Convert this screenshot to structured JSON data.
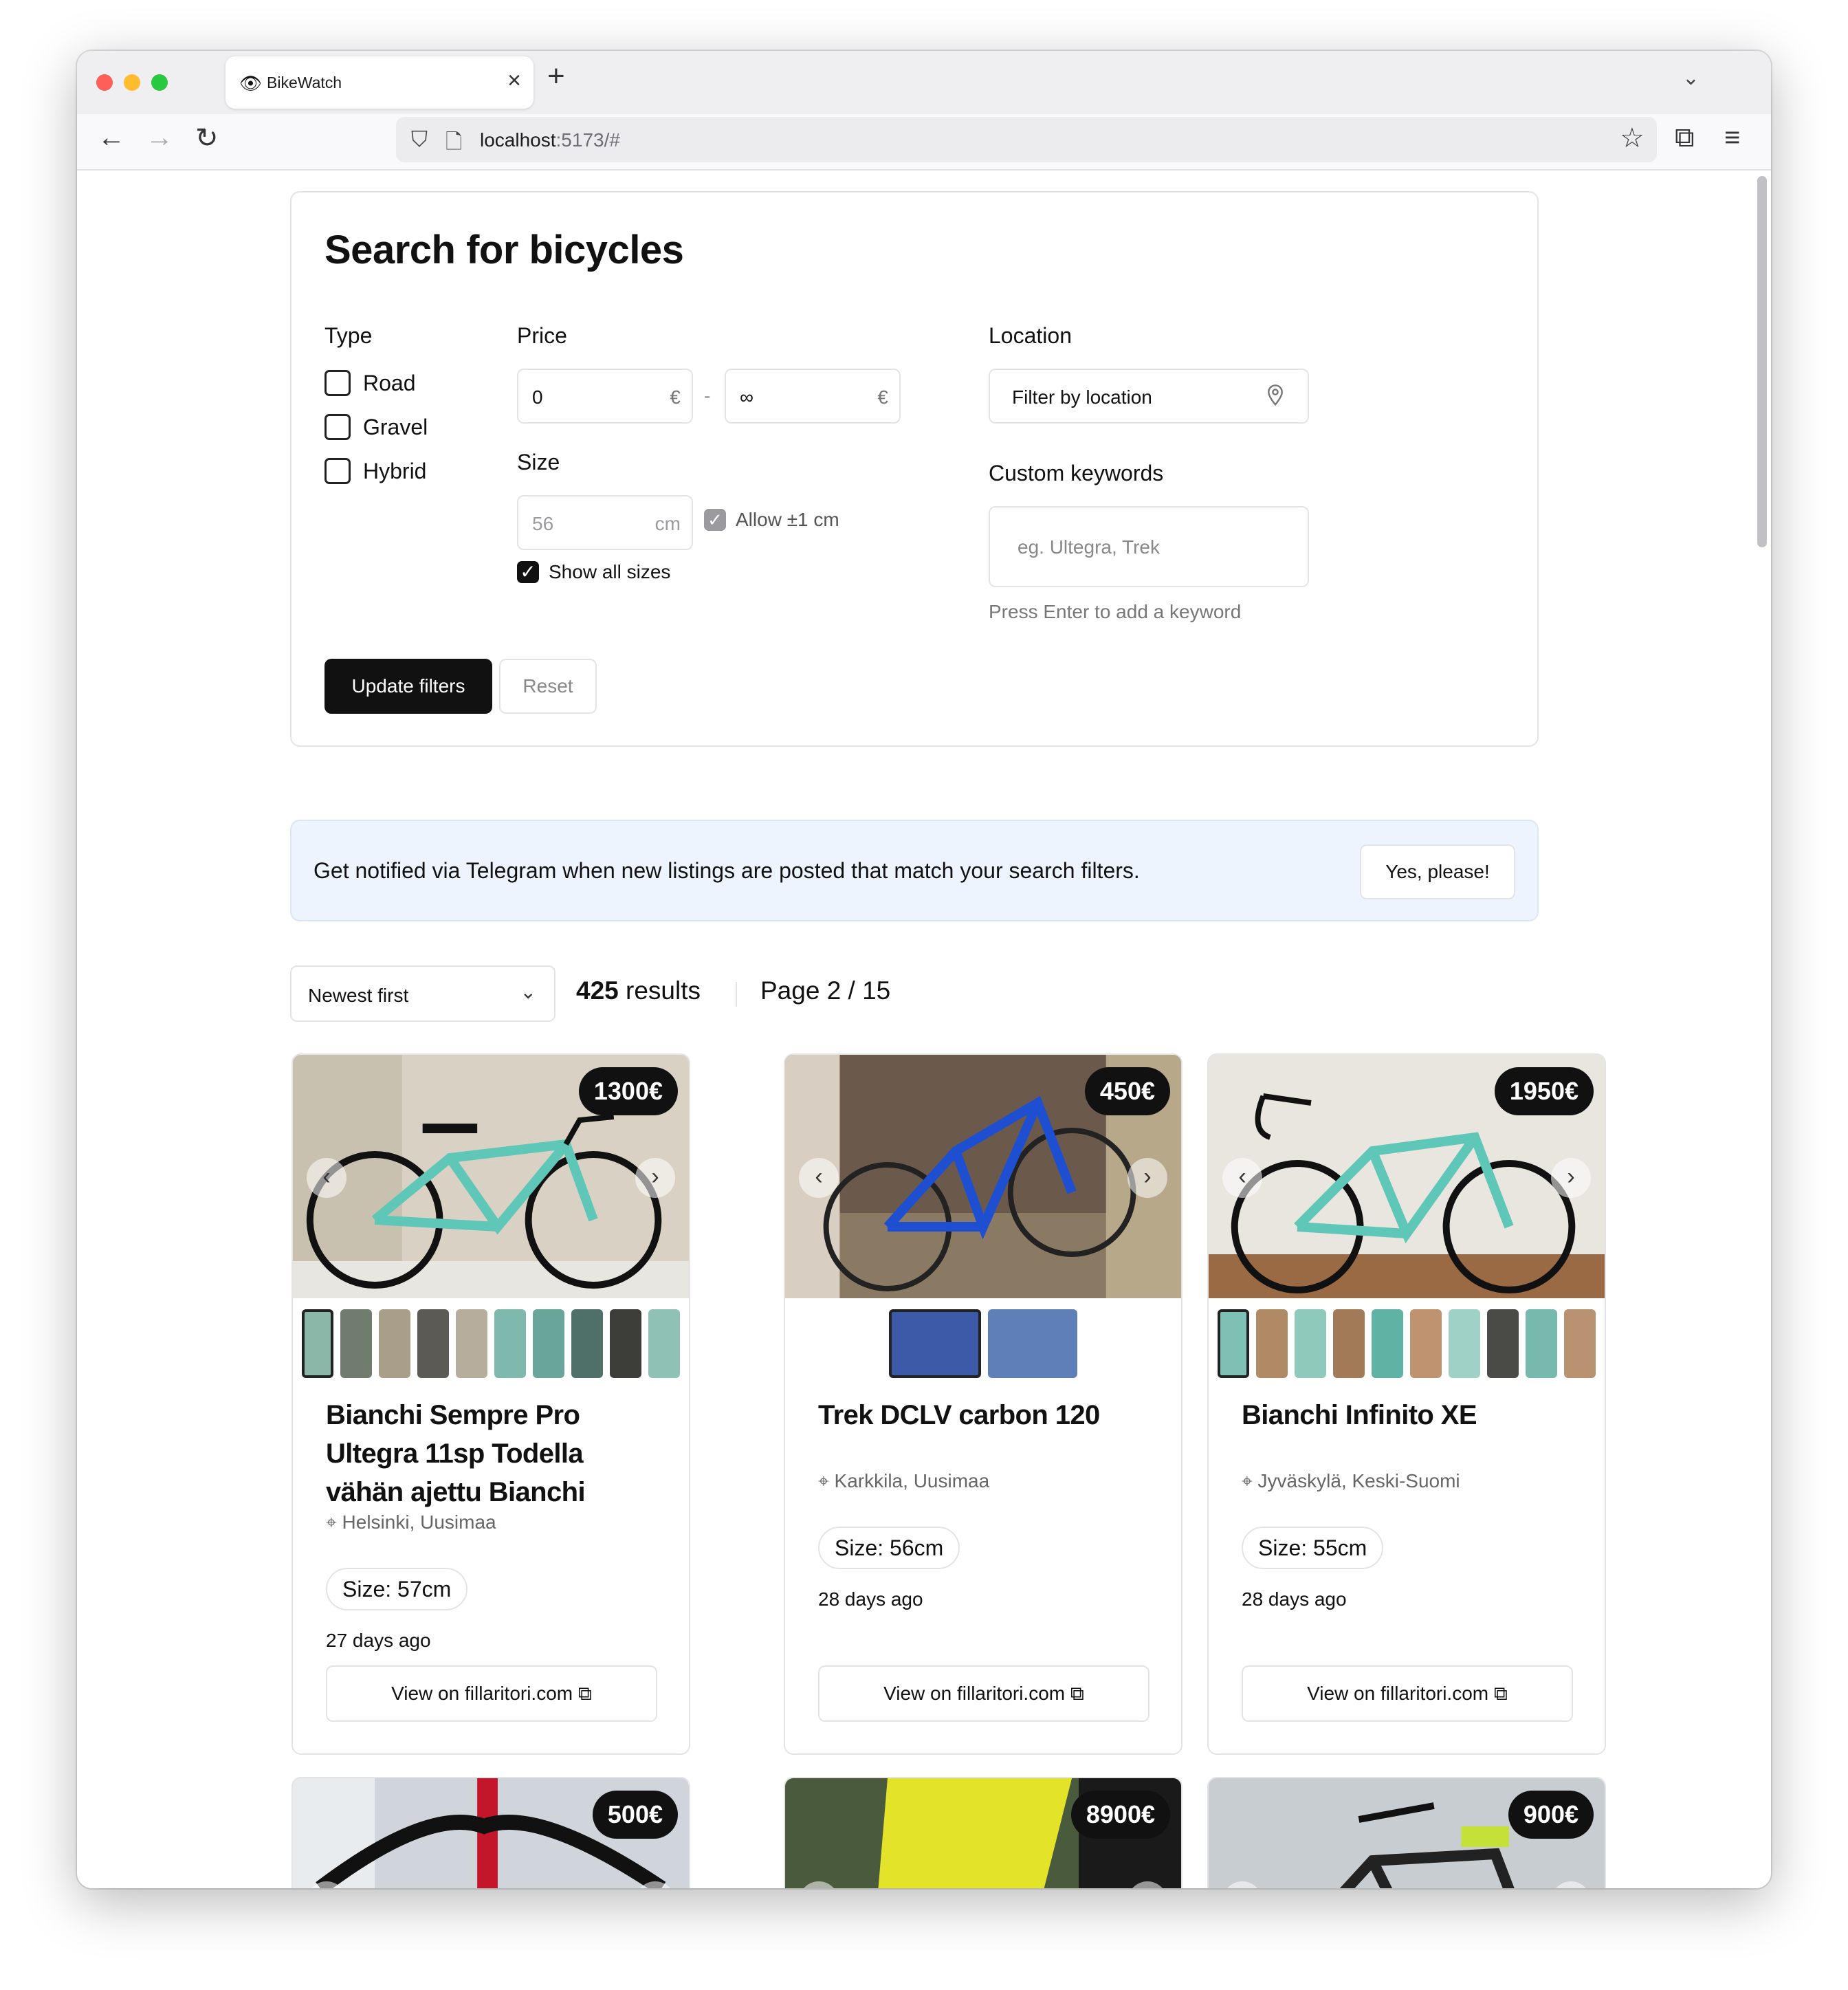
{
  "browser": {
    "tab_title": "BikeWatch",
    "url_host": "localhost",
    "url_rest": ":5173/#"
  },
  "filters": {
    "title": "Search for bicycles",
    "type_label": "Type",
    "types": [
      "Road",
      "Gravel",
      "Hybrid"
    ],
    "price_label": "Price",
    "price_min": "0",
    "price_max": "∞",
    "currency": "€",
    "price_separator": "-",
    "size_label": "Size",
    "size_value": "56",
    "size_unit": "cm",
    "allow_tolerance_label": "Allow ±1 cm",
    "show_all_sizes_label": "Show all sizes",
    "show_all_sizes_checked": true,
    "location_label": "Location",
    "location_placeholder": "Filter by location",
    "keywords_label": "Custom keywords",
    "keywords_placeholder": "eg. Ultegra, Trek",
    "keywords_hint": "Press Enter to add a keyword",
    "update_button": "Update filters",
    "reset_button": "Reset"
  },
  "notification": {
    "text": "Get notified via Telegram when new listings are posted that match your search filters.",
    "button": "Yes, please!"
  },
  "results_bar": {
    "sort_value": "Newest first",
    "count": "425",
    "count_suffix": "results",
    "page": "Page 2 / 15"
  },
  "listings": [
    {
      "price": "1300€",
      "title": "Bianchi Sempre Pro Ultegra 11sp Todella vähän ajettu Bianchi",
      "location": "Helsinki, Uusimaa",
      "size": "Size: 57cm",
      "ago": "27 days ago",
      "link": "View on fillaritori.com"
    },
    {
      "price": "450€",
      "title": "Trek DCLV carbon 120",
      "location": "Karkkila, Uusimaa",
      "size": "Size: 56cm",
      "ago": "28 days ago",
      "link": "View on fillaritori.com"
    },
    {
      "price": "1950€",
      "title": "Bianchi Infinito XE",
      "location": "Jyväskylä, Keski-Suomi",
      "size": "Size: 55cm",
      "ago": "28 days ago",
      "link": "View on fillaritori.com"
    },
    {
      "price": "500€"
    },
    {
      "price": "8900€"
    },
    {
      "price": "900€"
    }
  ],
  "colors": {
    "primary": "#111111",
    "banner_bg": "#eef4fe",
    "border": "#e4e4e7",
    "bianchi_celeste": "#5fc7b8"
  }
}
